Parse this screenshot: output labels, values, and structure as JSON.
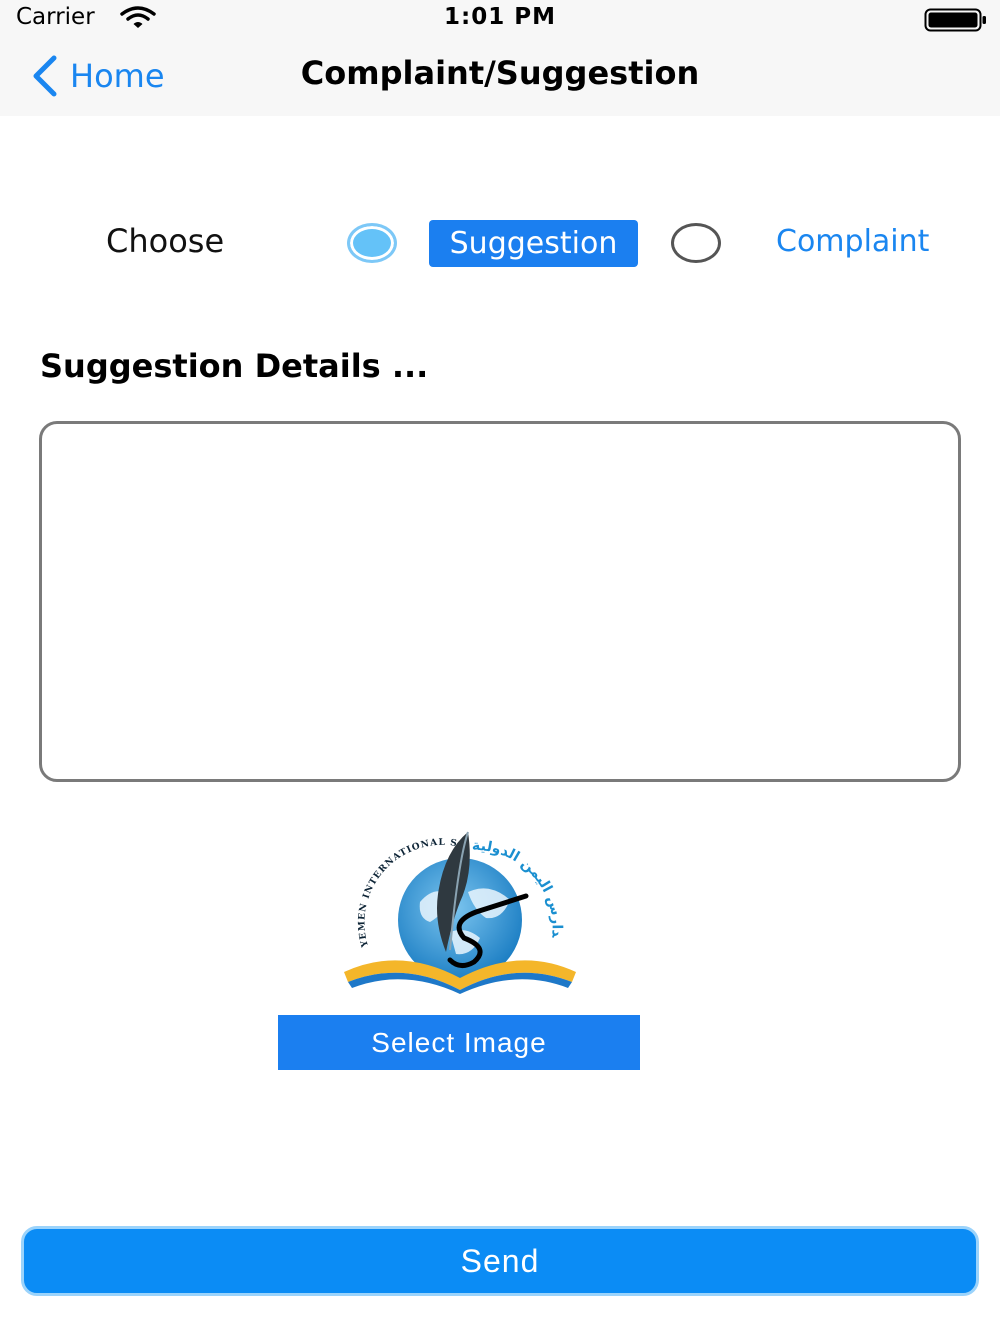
{
  "status_bar": {
    "carrier": "Carrier",
    "time": "1:01 PM",
    "wifi_icon": "wifi-icon",
    "battery_icon": "battery-icon"
  },
  "nav": {
    "back_label": "Home",
    "back_icon": "chevron-left-icon",
    "title": "Complaint/Suggestion"
  },
  "form": {
    "choose_label": "Choose",
    "options": [
      {
        "label": "Suggestion",
        "selected": true
      },
      {
        "label": "Complaint",
        "selected": false
      }
    ],
    "details_heading": "Suggestion Details ...",
    "details_value": "",
    "select_image_label": "Select Image",
    "send_label": "Send"
  },
  "logo": {
    "arc_text": "YEMEN INTERNATIONAL SCHOOL",
    "arabic_text": "مدارس اليمن الدولية"
  },
  "colors": {
    "accent": "#1b7ff0",
    "radio_selected": "#64c2f8",
    "send": "#0b8cf5"
  }
}
